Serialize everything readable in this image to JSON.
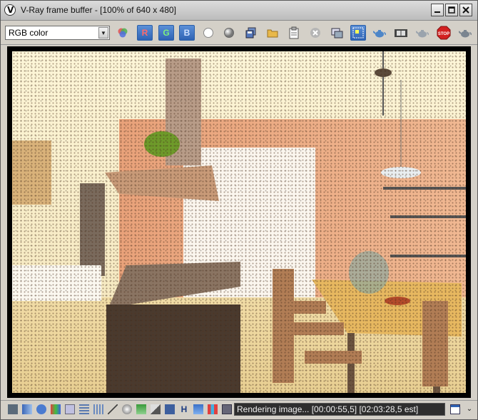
{
  "window": {
    "title": "V-Ray frame buffer - [100% of 640 x 480]",
    "controls": {
      "minimize": "_",
      "maximize": "□",
      "close": "✕"
    }
  },
  "toolbar": {
    "channel_select": {
      "value": "RGB color"
    },
    "red_channel": "R",
    "green_channel": "G",
    "blue_channel": "B",
    "stop_label": "STOP"
  },
  "status": {
    "text": "Rendering image... [00:00:55,5] [02:03:28,5 est]",
    "h_label": "H"
  },
  "colors": {
    "accent": "#2f63b4",
    "channel_red": "#ff5a5a",
    "channel_green": "#5fe05f",
    "channel_blue": "#7fb2ff"
  }
}
